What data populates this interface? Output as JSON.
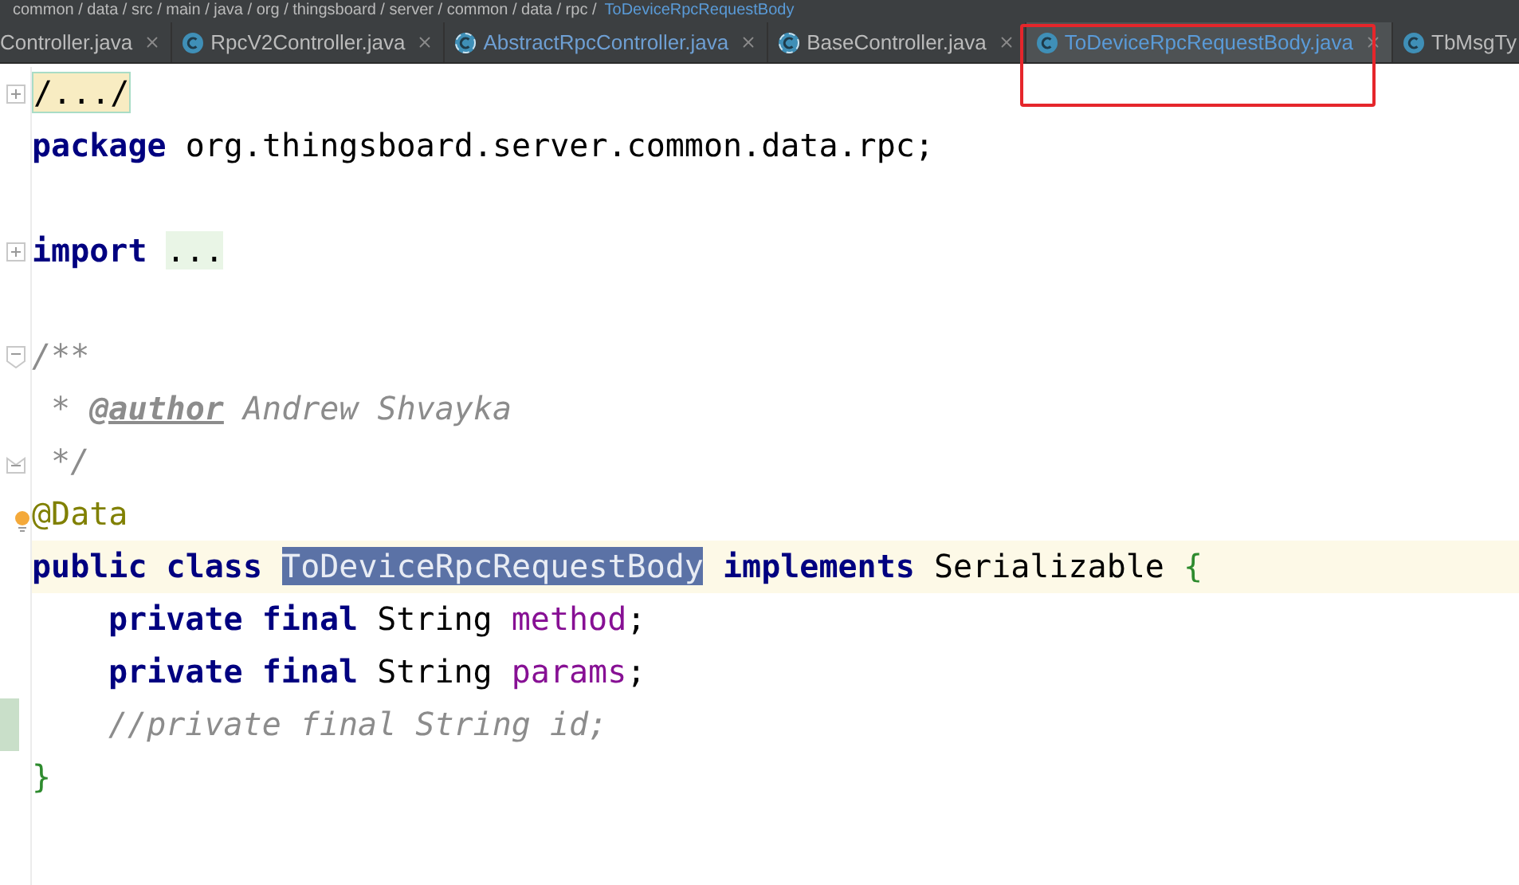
{
  "breadcrumb": {
    "path": "common / data / src / main / java / org / thingsboard / server / common / data / rpc /",
    "current": "ToDeviceRpcRequestBody"
  },
  "tabs": [
    {
      "label": "Controller.java",
      "selected": false,
      "color": "#bbbbbb"
    },
    {
      "label": "RpcV2Controller.java",
      "selected": false,
      "color": "#bbbbbb",
      "kind": "class"
    },
    {
      "label": "AbstractRpcController.java",
      "selected": false,
      "color": "#6e9fd3",
      "kind": "abstract"
    },
    {
      "label": "BaseController.java",
      "selected": false,
      "color": "#bbbbbb",
      "kind": "abstract"
    },
    {
      "label": "ToDeviceRpcRequestBody.java",
      "selected": true,
      "color": "#5a9bd8",
      "kind": "class"
    },
    {
      "label": "TbMsgTy",
      "selected": false,
      "color": "#bbbbbb",
      "kind": "class"
    }
  ],
  "lines": [
    {
      "kind": "folded",
      "tokens": [
        {
          "kind": "fold",
          "text": "/.../"
        }
      ]
    },
    {
      "tokens": [
        {
          "kind": "kw",
          "text": "package"
        },
        {
          "kind": "text",
          "text": "org.thingsboard.server.common.data.rpc;"
        }
      ]
    },
    {
      "kind": "blank"
    },
    {
      "kind": "folded",
      "tokens": [
        {
          "kind": "kw",
          "text": "import"
        },
        {
          "kind": "fold_green",
          "text": "..."
        }
      ]
    },
    {
      "kind": "blank"
    },
    {
      "kind": "fold_start",
      "tokens": [
        {
          "kind": "comment",
          "text": "/**"
        }
      ]
    },
    {
      "tokens": [
        {
          "kind": "comment",
          "text": " *"
        },
        {
          "kind": "doc_tag",
          "text": "@author"
        },
        {
          "kind": "comment",
          "text": "Andrew Shvayka"
        }
      ]
    },
    {
      "kind": "fold_end",
      "tokens": [
        {
          "kind": "comment",
          "text": " */"
        }
      ]
    },
    {
      "intention": true,
      "tokens": [
        {
          "kind": "annotation",
          "text": "@Data"
        }
      ]
    },
    {
      "current": true,
      "tokens": [
        {
          "kind": "kw",
          "text": "public class"
        },
        {
          "kind": "selection",
          "text": "ToDeviceRpcRequestBody"
        },
        {
          "kind": "kw",
          "text": "implements"
        },
        {
          "kind": "text",
          "text": "Serializable"
        },
        {
          "kind": "brace",
          "text": "{"
        }
      ]
    },
    {
      "indented": true,
      "tokens": [
        {
          "kind": "kw",
          "text": "private final"
        },
        {
          "kind": "text",
          "text": "String"
        },
        {
          "kind": "field",
          "text": "method"
        },
        {
          "kind": "punct",
          "text": ";"
        }
      ]
    },
    {
      "indented": true,
      "tokens": [
        {
          "kind": "kw",
          "text": "private final"
        },
        {
          "kind": "text",
          "text": "String"
        },
        {
          "kind": "field",
          "text": "params"
        },
        {
          "kind": "punct",
          "text": ";"
        }
      ]
    },
    {
      "indented": true,
      "changed": true,
      "tokens": [
        {
          "kind": "comment",
          "text": "//private final String id;"
        }
      ]
    },
    {
      "tokens": [
        {
          "kind": "brace",
          "text": "}"
        }
      ]
    }
  ],
  "annotation_box": {
    "shown": true
  }
}
